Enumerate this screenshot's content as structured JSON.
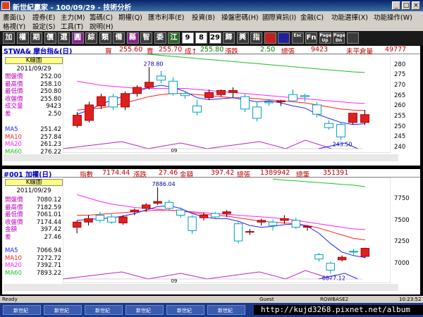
{
  "titlebar": {
    "title": "新世紀贏家 - 100/09/29 - 技術分析"
  },
  "menubar": {
    "row1": [
      "畫面(L)",
      "證券(E)",
      "主力(M)",
      "籌碼(C)",
      "期權(Q)",
      "匯市利率(E)",
      "投資(B)",
      "操盤密碼(H)",
      "國際資訊(I)",
      "金融(C)",
      "功能選擇(X)",
      "功能操作(W)"
    ],
    "row2": [
      "格視(Y)",
      "設定(S)",
      "工具(T)",
      "說明(H)"
    ]
  },
  "toolbar": {
    "buttons": [
      {
        "label": "加",
        "color": "#ffffff",
        "bg": "#3a3a3a"
      },
      {
        "label": "權",
        "color": "#ffffff",
        "bg": "#3a3a3a"
      },
      {
        "label": "期",
        "color": "#ffffff",
        "bg": "#3a3a3a"
      },
      {
        "label": "價",
        "color": "#ffffff",
        "bg": "#3a3a3a"
      },
      {
        "label": "選",
        "color": "#ffffff",
        "bg": "#3a3a3a"
      },
      {
        "label": "圓",
        "color": "#ffffff",
        "bg": "#8a2090"
      },
      {
        "label": "綜",
        "color": "#ffffff",
        "bg": "#3a3a3a"
      },
      {
        "label": "類",
        "color": "#ffffff",
        "bg": "#3a3a3a"
      },
      {
        "label": "備",
        "color": "#ffffff",
        "bg": "#3a3a3a"
      },
      {
        "label": "縣",
        "color": "#ffffff",
        "bg": "#8a2090"
      },
      {
        "label": "智",
        "color": "#ffffff",
        "bg": "#3a3a3a"
      },
      {
        "label": "委",
        "color": "#ffffff",
        "bg": "#3a3a3a"
      },
      {
        "label": "江",
        "color": "#ffffff",
        "bg": "#2a6a2a"
      },
      {
        "label": "9",
        "color": "#000000",
        "bg": "#ffffff"
      },
      {
        "label": "8",
        "color": "#000000",
        "bg": "#ffffff"
      },
      {
        "label": "29",
        "color": "#000000",
        "bg": "#ffffff"
      },
      {
        "label": "歸",
        "color": "#ffffff",
        "bg": "#3a3a3a"
      },
      {
        "label": "興",
        "color": "#ffffff",
        "bg": "#3a3a3a"
      },
      {
        "label": "指",
        "color": "#ffffff",
        "bg": "#3a3a3a"
      },
      {
        "label": "",
        "color": "#ffffff",
        "bg": "#c02020"
      },
      {
        "label": "",
        "color": "#ffffff",
        "bg": "#2020a0"
      },
      {
        "label": "Esc",
        "color": "#ffffff",
        "bg": "#3a3a3a"
      },
      {
        "label": "Fn",
        "color": "#ffffff",
        "bg": "#3a3a3a"
      },
      {
        "label": "Page Up",
        "color": "#ffffff",
        "bg": "#3a3a3a"
      },
      {
        "label": "Page Dn",
        "color": "#ffffff",
        "bg": "#3a3a3a"
      },
      {
        "label": "",
        "color": "#ffffff",
        "bg": "#3a3a3a"
      }
    ]
  },
  "panel1": {
    "title": "STWA& 摩台指&(日)",
    "buy_label": "買",
    "buy": "255.60",
    "sell_label": "賣",
    "sell": "255.70",
    "trade_label": "成↑",
    "trade": "255.80",
    "change_label": "漲跌",
    "change": "2.50",
    "volume_label": "總張",
    "volume": "9423",
    "oi_label": "未平倉量",
    "oi": "49777",
    "kbox": "K線圖",
    "date": "2011/09/29",
    "fields": [
      {
        "label": "開盤價",
        "value": "252.00"
      },
      {
        "label": "最高價",
        "value": "258.10"
      },
      {
        "label": "最低價",
        "value": "250.80"
      },
      {
        "label": "收盤價",
        "value": "255.80"
      },
      {
        "label": "成交量",
        "value": "9423"
      },
      {
        "label": "差",
        "value": "2.50"
      }
    ],
    "ma": [
      {
        "label": "MA5",
        "value": "251.42",
        "color": "#2020ff"
      },
      {
        "label": "MA10",
        "value": "257.84",
        "color": "#ff2020"
      },
      {
        "label": "MA20",
        "value": "261.23",
        "color": "#ff20ff"
      },
      {
        "label": "MA60",
        "value": "276.22",
        "color": "#20c020"
      }
    ],
    "yticks": [
      "280",
      "275",
      "270",
      "265",
      "260",
      "255",
      "250",
      "245",
      "240"
    ],
    "peak_label": "278.80",
    "trough_label": "243.50",
    "xlabel": "09"
  },
  "panel2": {
    "title": "#001 加權(日)",
    "index_label": "指數",
    "index": "7174.44",
    "change_label": "漲跌",
    "change": "27.46",
    "amount_label": "金額",
    "amount": "397.42",
    "volume_label": "總張",
    "volume": "1389942",
    "count_label": "總筆",
    "count": "351391",
    "kbox": "K線圖",
    "date": "2011/09/29",
    "fields": [
      {
        "label": "開盤價",
        "value": "7080.12"
      },
      {
        "label": "最高價",
        "value": "7182.59"
      },
      {
        "label": "最低價",
        "value": "7061.01"
      },
      {
        "label": "收盤價",
        "value": "7174.44"
      },
      {
        "label": "金額",
        "value": "397.42"
      },
      {
        "label": "差",
        "value": "27.46"
      }
    ],
    "ma": [
      {
        "label": "MA5",
        "value": "7066.94",
        "color": "#2020ff"
      },
      {
        "label": "MA10",
        "value": "7272.72",
        "color": "#ff2020"
      },
      {
        "label": "MA20",
        "value": "7392.71",
        "color": "#ff20ff"
      },
      {
        "label": "MA60",
        "value": "7893.22",
        "color": "#20c020"
      }
    ],
    "yticks": [
      "7750",
      "7500",
      "7250",
      "7000"
    ],
    "peak_label": "7886.04",
    "trough_label": "6877.12",
    "xlabel": "09"
  },
  "statusbar": {
    "ready": "Ready",
    "user": "Guest",
    "server": "ROWBASE2",
    "time": "10:23:52"
  },
  "taskbar": {
    "items": [
      "新世紀",
      "新世紀",
      "新世紀",
      "新世紀",
      "新世紀",
      "新世紀"
    ],
    "watermark": "http://kujd3268.pixnet.net/album"
  },
  "chart_data": [
    {
      "type": "candlestick",
      "title": "STWA& 摩台指&(日)",
      "ylim": [
        240,
        283
      ],
      "candles": [
        {
          "o": 250.5,
          "h": 257,
          "l": 249.5,
          "c": 255.5
        },
        {
          "o": 253,
          "h": 262,
          "l": 252,
          "c": 260.5
        },
        {
          "o": 260,
          "h": 266,
          "l": 258.5,
          "c": 264.5
        },
        {
          "o": 264.5,
          "h": 266,
          "l": 258,
          "c": 259.5
        },
        {
          "o": 259.5,
          "h": 267,
          "l": 258,
          "c": 266
        },
        {
          "o": 266,
          "h": 270,
          "l": 264.5,
          "c": 269
        },
        {
          "o": 269,
          "h": 278.8,
          "l": 268,
          "c": 271.5
        },
        {
          "o": 274.5,
          "h": 277,
          "l": 271,
          "c": 272.5
        },
        {
          "o": 272,
          "h": 274,
          "l": 265,
          "c": 266
        },
        {
          "o": 266,
          "h": 267,
          "l": 263.5,
          "c": 265
        },
        {
          "o": 260,
          "h": 263,
          "l": 255.5,
          "c": 257
        },
        {
          "o": 264,
          "h": 268,
          "l": 263,
          "c": 266.5
        },
        {
          "o": 265.5,
          "h": 268,
          "l": 264.5,
          "c": 267.5
        },
        {
          "o": 266.5,
          "h": 269,
          "l": 264,
          "c": 267.5
        },
        {
          "o": 264.5,
          "h": 266,
          "l": 257,
          "c": 258.5
        },
        {
          "o": 259.5,
          "h": 262,
          "l": 252.5,
          "c": 254
        },
        {
          "o": 262,
          "h": 263,
          "l": 260,
          "c": 261.5
        },
        {
          "o": 262,
          "h": 263,
          "l": 260,
          "c": 262.5
        },
        {
          "o": 265.5,
          "h": 268,
          "l": 263,
          "c": 262.5
        },
        {
          "o": 265,
          "h": 266,
          "l": 262,
          "c": 264.5
        },
        {
          "o": 260.5,
          "h": 262,
          "l": 254.5,
          "c": 256
        },
        {
          "o": 251.5,
          "h": 253,
          "l": 248.5,
          "c": 249.5
        },
        {
          "o": 251,
          "h": 252,
          "l": 243.5,
          "c": 245
        },
        {
          "o": 252,
          "h": 255,
          "l": 251,
          "c": 256.5
        },
        {
          "o": 252,
          "h": 258.1,
          "l": 250.8,
          "c": 255.8
        }
      ],
      "ma5": [
        256,
        258,
        261,
        263,
        265,
        267,
        269,
        270,
        269,
        267,
        264,
        263,
        263.5,
        264,
        263,
        262,
        262.5,
        261.5,
        260,
        259,
        256,
        254,
        252,
        251,
        251.4
      ],
      "ma10": [
        258,
        258.5,
        259,
        260,
        261.5,
        263,
        264.5,
        265.5,
        266,
        266,
        265.5,
        265,
        264.5,
        264,
        264,
        263.5,
        263,
        262.5,
        262,
        261.5,
        260.5,
        259.5,
        258.5,
        258,
        257.8
      ],
      "ma20": [
        272,
        271,
        270,
        269.5,
        269,
        268.5,
        268.5,
        268.5,
        268.5,
        268.5,
        268,
        267.5,
        267,
        266.5,
        266,
        265.5,
        265,
        264.5,
        264,
        263.5,
        263,
        262.5,
        262,
        261.5,
        261.2
      ],
      "ma60": [
        286,
        285.5,
        285,
        284.5,
        284,
        283.5,
        283,
        282.5,
        282,
        281.5,
        281,
        280.5,
        280,
        279.5,
        279,
        278.5,
        278,
        277.5,
        277,
        276.5,
        276.2
      ]
    },
    {
      "type": "candlestick",
      "title": "#001 加權(日)",
      "ylim": [
        6850,
        7950
      ],
      "candles": [
        {
          "o": 7420,
          "h": 7500,
          "l": 7350,
          "c": 7480
        },
        {
          "o": 7480,
          "h": 7560,
          "l": 7440,
          "c": 7520
        },
        {
          "o": 7560,
          "h": 7600,
          "l": 7470,
          "c": 7500
        },
        {
          "o": 7540,
          "h": 7580,
          "l": 7460,
          "c": 7480
        },
        {
          "o": 7470,
          "h": 7560,
          "l": 7450,
          "c": 7540
        },
        {
          "o": 7600,
          "h": 7640,
          "l": 7560,
          "c": 7620
        },
        {
          "o": 7640,
          "h": 7700,
          "l": 7600,
          "c": 7680
        },
        {
          "o": 7700,
          "h": 7886,
          "l": 7680,
          "c": 7720
        },
        {
          "o": 7710,
          "h": 7740,
          "l": 7620,
          "c": 7640
        },
        {
          "o": 7620,
          "h": 7650,
          "l": 7530,
          "c": 7560
        },
        {
          "o": 7540,
          "h": 7560,
          "l": 7340,
          "c": 7380
        },
        {
          "o": 7530,
          "h": 7590,
          "l": 7500,
          "c": 7560
        },
        {
          "o": 7580,
          "h": 7600,
          "l": 7520,
          "c": 7540
        },
        {
          "o": 7580,
          "h": 7620,
          "l": 7540,
          "c": 7600
        },
        {
          "o": 7460,
          "h": 7480,
          "l": 7230,
          "c": 7260
        },
        {
          "o": 7370,
          "h": 7400,
          "l": 7330,
          "c": 7370
        },
        {
          "o": 7480,
          "h": 7520,
          "l": 7440,
          "c": 7500
        },
        {
          "o": 7480,
          "h": 7510,
          "l": 7380,
          "c": 7440
        },
        {
          "o": 7500,
          "h": 7560,
          "l": 7460,
          "c": 7520
        },
        {
          "o": 7500,
          "h": 7530,
          "l": 7400,
          "c": 7420
        },
        {
          "o": 7420,
          "h": 7440,
          "l": 7380,
          "c": 7430
        },
        {
          "o": 7100,
          "h": 7120,
          "l": 7020,
          "c": 7050
        },
        {
          "o": 7000,
          "h": 7020,
          "l": 6877.12,
          "c": 6920
        },
        {
          "o": 7040,
          "h": 7090,
          "l": 7020,
          "c": 7070
        },
        {
          "o": 7140,
          "h": 7170,
          "l": 7100,
          "c": 7130
        },
        {
          "o": 7080.12,
          "h": 7182.59,
          "l": 7061.01,
          "c": 7174.44
        }
      ],
      "ma5": [
        7500,
        7510,
        7520,
        7530,
        7550,
        7580,
        7620,
        7660,
        7670,
        7640,
        7580,
        7540,
        7520,
        7520,
        7490,
        7440,
        7420,
        7430,
        7450,
        7460,
        7430,
        7350,
        7230,
        7130,
        7090,
        7066.94
      ],
      "ma10": [
        7560,
        7560,
        7570,
        7580,
        7590,
        7600,
        7610,
        7620,
        7620,
        7610,
        7590,
        7570,
        7560,
        7550,
        7530,
        7510,
        7490,
        7480,
        7470,
        7460,
        7440,
        7410,
        7370,
        7330,
        7290,
        7272.72
      ],
      "ma20": [
        7800,
        7760,
        7720,
        7690,
        7670,
        7650,
        7640,
        7630,
        7620,
        7610,
        7600,
        7590,
        7580,
        7570,
        7560,
        7550,
        7540,
        7530,
        7520,
        7500,
        7480,
        7460,
        7440,
        7420,
        7400,
        7392.71
      ],
      "ma60": [
        7980,
        7970,
        7960,
        7950,
        7940,
        7930,
        7920,
        7910,
        7893.22
      ]
    }
  ]
}
